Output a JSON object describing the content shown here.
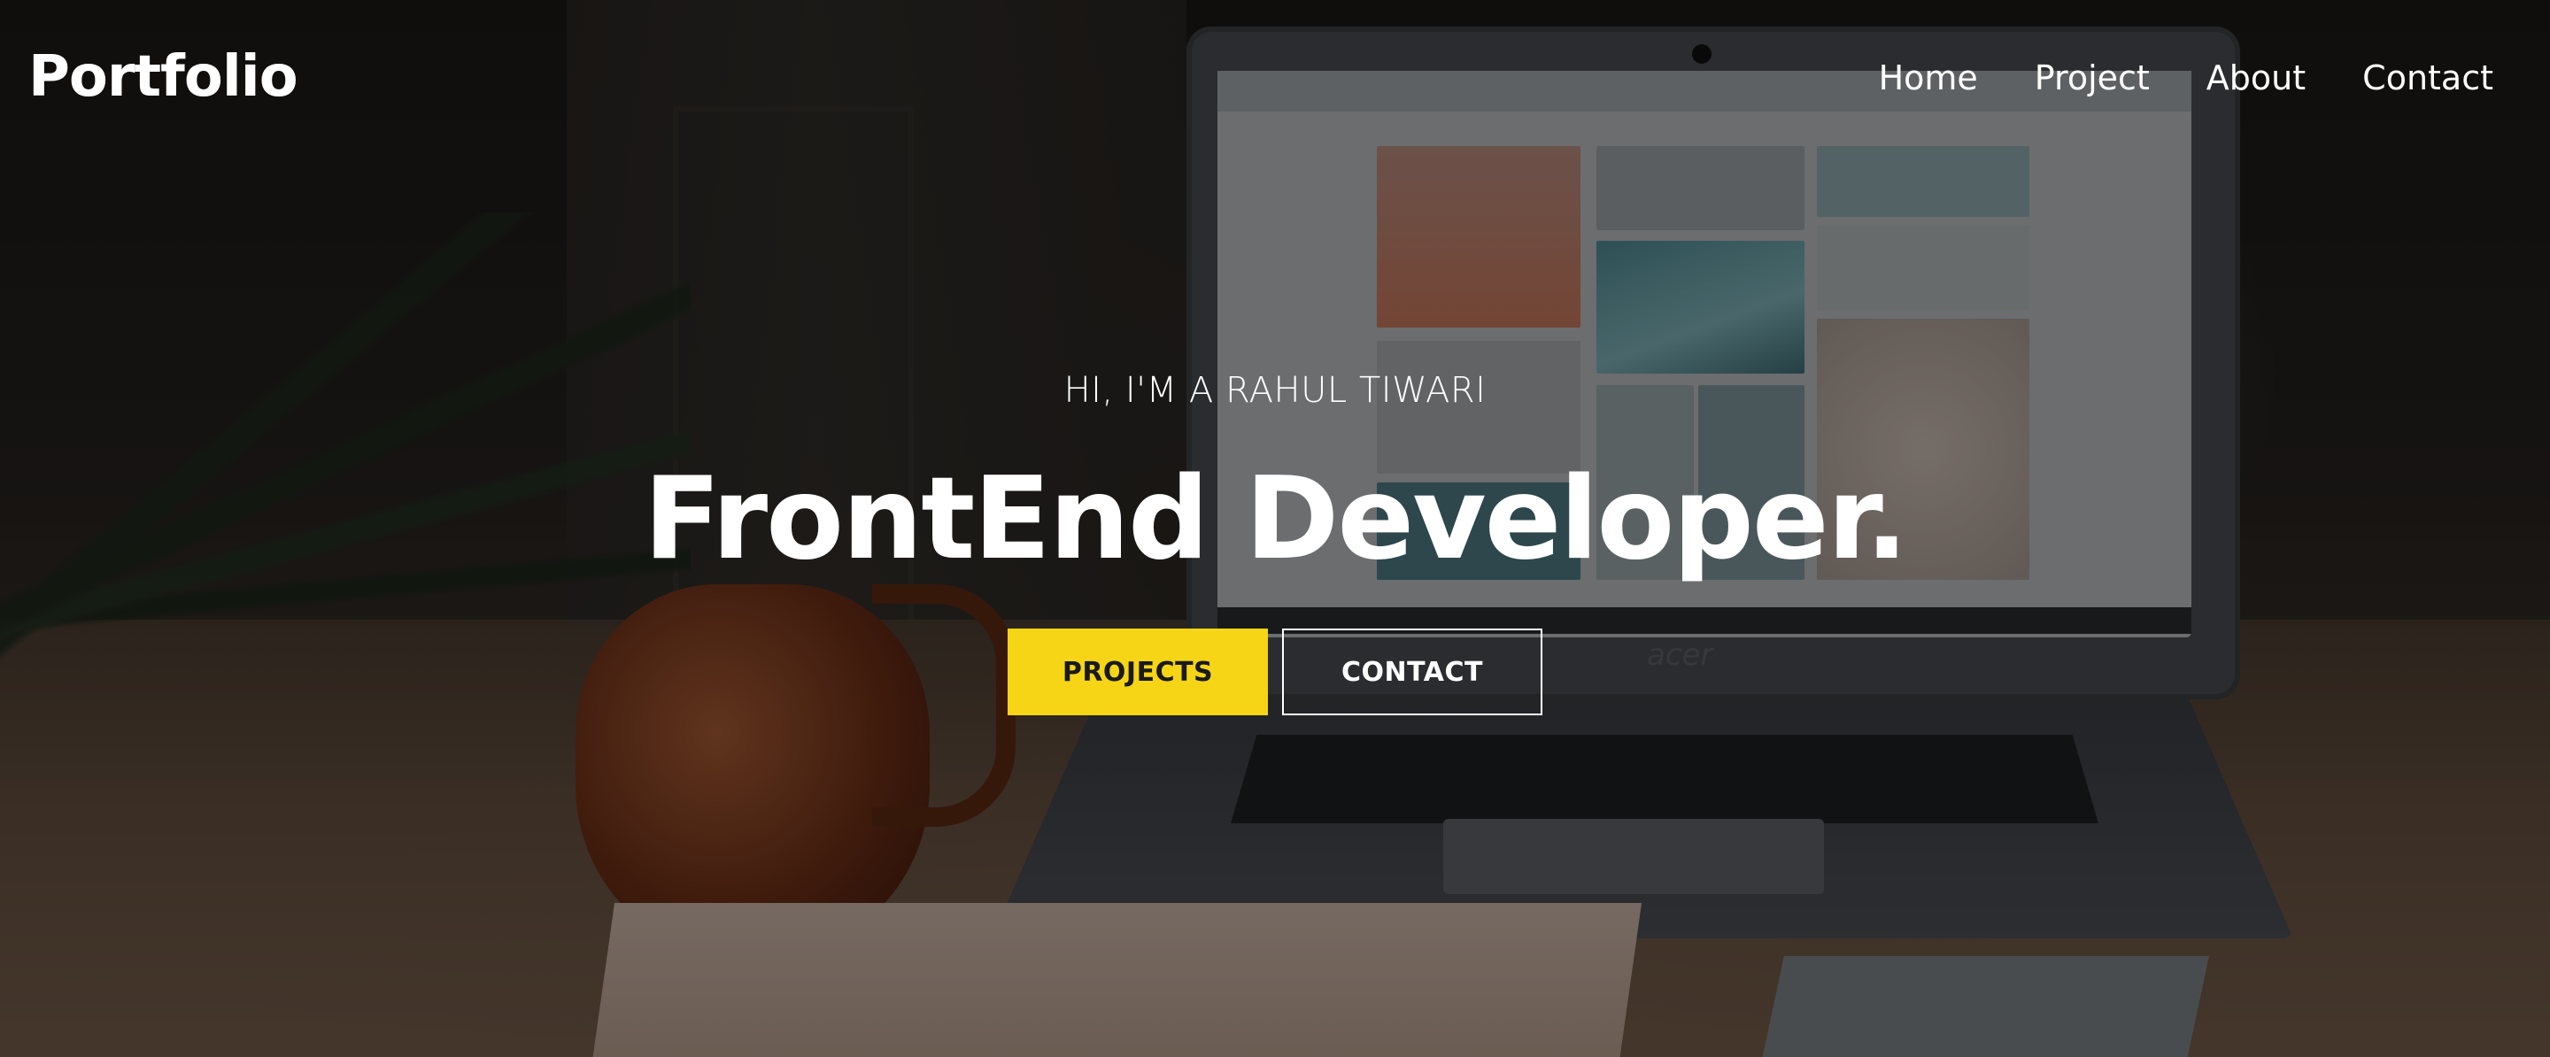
{
  "navbar": {
    "logo": "Portfolio",
    "links": [
      {
        "label": "Home"
      },
      {
        "label": "Project"
      },
      {
        "label": "About"
      },
      {
        "label": "Contact"
      }
    ]
  },
  "hero": {
    "subtitle": "HI, I'M A RAHUL TIWARI",
    "title": "FrontEnd Developer.",
    "buttons": {
      "primary_label": "PROJECTS",
      "secondary_label": "CONTACT"
    },
    "background_image_brand": "acer"
  },
  "colors": {
    "accent": "#f5d516",
    "text": "#ffffff",
    "overlay": "#000000"
  }
}
